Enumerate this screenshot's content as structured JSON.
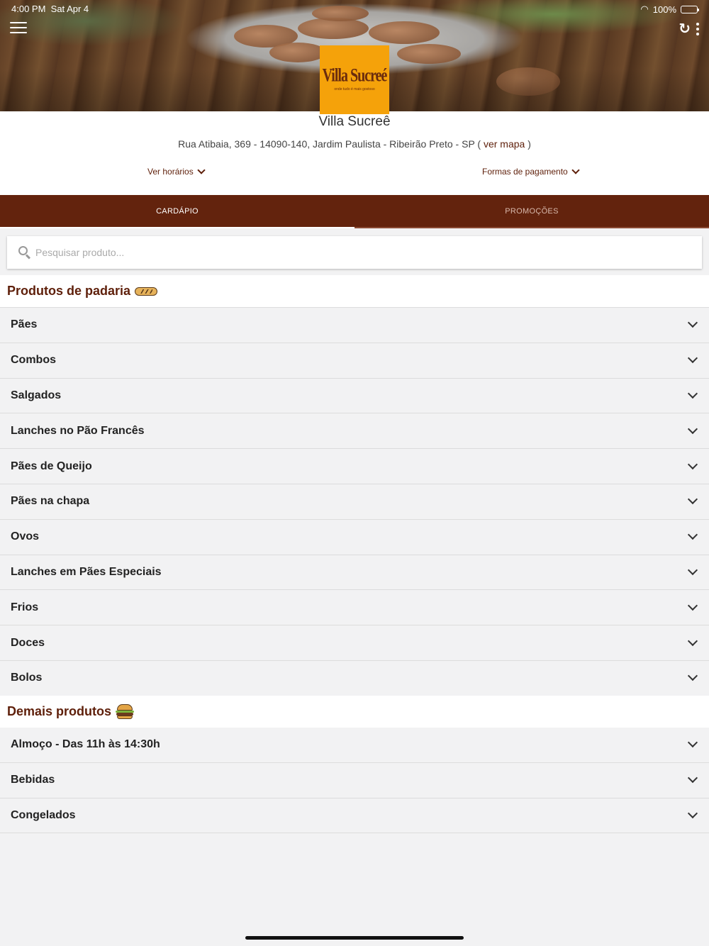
{
  "status_bar": {
    "time": "4:00 PM",
    "date": "Sat Apr 4",
    "battery": "100%",
    "battery_level": 1.0
  },
  "store": {
    "name": "Villa Sucreê",
    "logo_text": "Villa Sucreé",
    "logo_tagline": "onde tudo é mais gostoso",
    "address": "Rua Atibaia, 369 - 14090-140, Jardim Paulista - Ribeirão Preto - SP (",
    "map_link": "ver mapa",
    "address_close": ")",
    "hours_link": "Ver horários",
    "payment_link": "Formas de pagamento",
    "brand_color": "#63230d",
    "logo_color": "#f5a20a"
  },
  "tabs": [
    {
      "label": "CARDÁPIO",
      "active": true
    },
    {
      "label": "PROMOÇÕES",
      "active": false
    }
  ],
  "search": {
    "placeholder": "Pesquisar produto..."
  },
  "sections": [
    {
      "title": "Produtos de padaria",
      "icon": "bread-icon",
      "items": [
        "Pães",
        "Combos",
        "Salgados",
        "Lanches no Pão Francês",
        "Pães de Queijo",
        "Pães na chapa",
        "Ovos",
        "Lanches em Pães Especiais",
        "Frios",
        "Doces",
        "Bolos"
      ]
    },
    {
      "title": "Demais produtos",
      "icon": "burger-icon",
      "items": [
        "Almoço - Das 11h às 14:30h",
        "Bebidas",
        "Congelados"
      ]
    }
  ]
}
